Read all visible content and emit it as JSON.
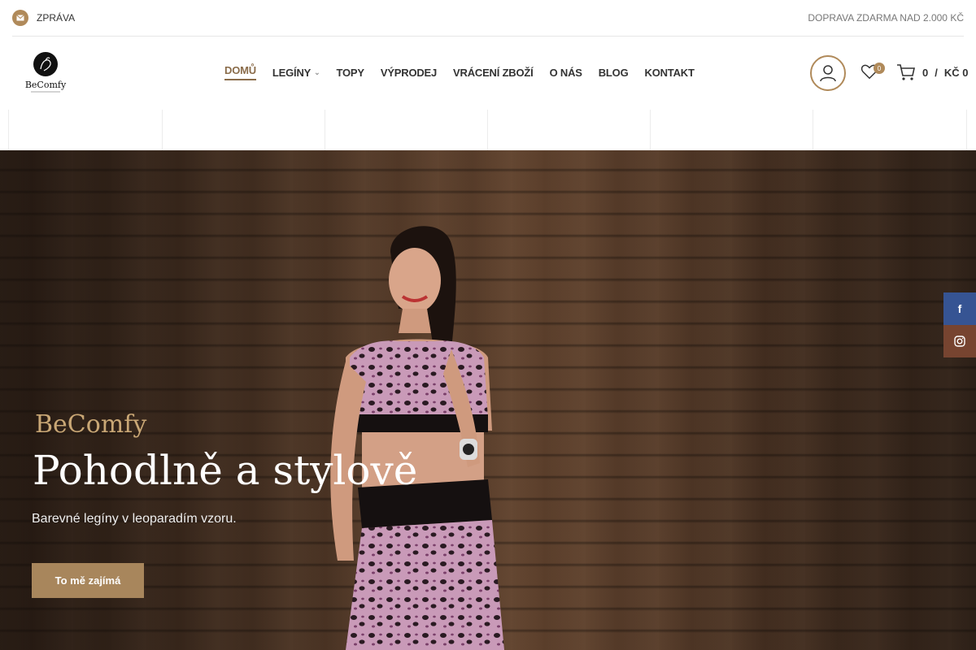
{
  "topbar": {
    "message_label": "ZPRÁVA",
    "shipping_notice": "DOPRAVA ZDARMA NAD 2.000 KČ"
  },
  "header": {
    "logo_text": "BeComfy",
    "nav": [
      {
        "label": "DOMŮ",
        "active": true
      },
      {
        "label": "LEGÍNY",
        "has_dropdown": true
      },
      {
        "label": "TOPY"
      },
      {
        "label": "VÝPRODEJ"
      },
      {
        "label": "VRÁCENÍ ZBOŽÍ"
      },
      {
        "label": "O NÁS"
      },
      {
        "label": "BLOG"
      },
      {
        "label": "KONTAKT"
      }
    ],
    "wishlist_count": "0",
    "cart_count": "0",
    "cart_separator": "/",
    "cart_total": "KČ 0"
  },
  "hero": {
    "brand": "BeComfy",
    "title": "Pohodlně a stylově",
    "subtitle": "Barevné legíny v leoparadím vzoru.",
    "cta": "To mě zajímá"
  },
  "social": {
    "facebook_icon": "f",
    "instagram_icon": "instagram-icon"
  },
  "colors": {
    "accent": "#b08a5a",
    "facebook": "#365493",
    "instagram": "#774430"
  }
}
